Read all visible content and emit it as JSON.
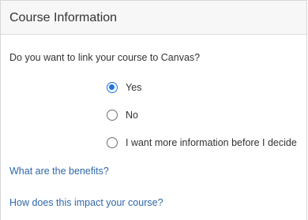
{
  "panel": {
    "title": "Course Information"
  },
  "question": "Do you want to link your course to Canvas?",
  "options": [
    {
      "label": "Yes",
      "selected": true
    },
    {
      "label": "No",
      "selected": false
    },
    {
      "label": "I want more information before I decide",
      "selected": false
    }
  ],
  "links": {
    "benefits": "What are the benefits?",
    "impact": "How does this impact your course?"
  },
  "colors": {
    "radio_accent": "#1a73e8",
    "link": "#2f67a8",
    "header_bg": "#f7f7f7"
  }
}
